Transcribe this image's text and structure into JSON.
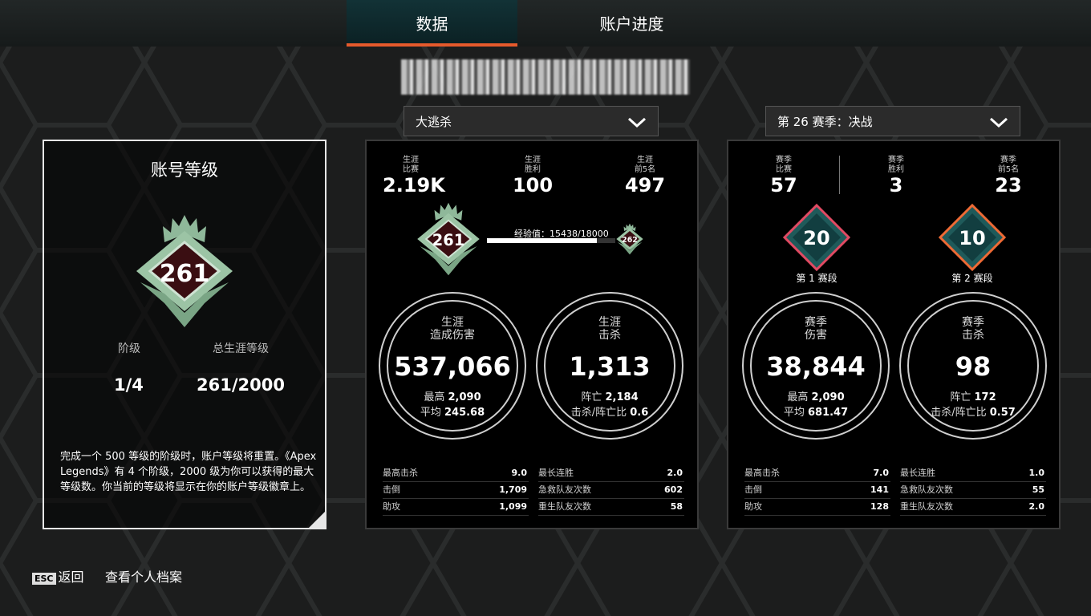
{
  "tabs": [
    {
      "label": "数据",
      "active": true
    },
    {
      "label": "账户进度",
      "active": false
    }
  ],
  "accent_color": "#e65a2c",
  "dropdowns": {
    "mode": "大逃杀",
    "season": "第 26 赛季：决战"
  },
  "account_level": {
    "title": "账号等级",
    "badge_level": "261",
    "tier_label": "阶级",
    "tier_value": "1/4",
    "total_label": "总生涯等级",
    "total_value": "261/2000",
    "description": "完成一个 500 等级的阶级时，账户等级将重置。《Apex Legends》有 4 个阶级，2000 级为你可以获得的最大等级数。你当前的等级将显示在你的账户等级徽章上。"
  },
  "career": {
    "top_stats": [
      {
        "label1": "生涯",
        "label2": "比赛",
        "value": "2.19K"
      },
      {
        "label1": "生涯",
        "label2": "胜利",
        "value": "100"
      },
      {
        "label1": "生涯",
        "label2": "前5名",
        "value": "497"
      }
    ],
    "badge_level": "261",
    "next_level": "262",
    "xp_label": "经验值：15438/18000",
    "xp_progress": 0.8577,
    "damage": {
      "label1": "生涯",
      "label2": "造成伤害",
      "value": "537,066",
      "sub1_label": "最高",
      "sub1_value": "2,090",
      "sub2_label": "平均",
      "sub2_value": "245.68"
    },
    "kills": {
      "label1": "生涯",
      "label2": "击杀",
      "value": "1,313",
      "sub1_label": "阵亡",
      "sub1_value": "2,184",
      "sub2_label": "击杀/阵亡比",
      "sub2_value": "0.6"
    },
    "left_rows": [
      {
        "label": "最高击杀",
        "value": "9.0"
      },
      {
        "label": "击倒",
        "value": "1,709"
      },
      {
        "label": "助攻",
        "value": "1,099"
      }
    ],
    "right_rows": [
      {
        "label": "最长连胜",
        "value": "2.0"
      },
      {
        "label": "急救队友次数",
        "value": "602"
      },
      {
        "label": "重生队友次数",
        "value": "58"
      }
    ]
  },
  "season": {
    "top_stats": [
      {
        "label1": "赛季",
        "label2": "比赛",
        "value": "57"
      },
      {
        "label1": "赛季",
        "label2": "胜利",
        "value": "3"
      },
      {
        "label1": "赛季",
        "label2": "前5名",
        "value": "23"
      }
    ],
    "split1": {
      "value": "20",
      "label": "第 1 赛段",
      "color": "#e24a63"
    },
    "split2": {
      "value": "10",
      "label": "第 2 赛段",
      "color": "#ef6a35"
    },
    "damage": {
      "label1": "赛季",
      "label2": "伤害",
      "value": "38,844",
      "sub1_label": "最高",
      "sub1_value": "2,090",
      "sub2_label": "平均",
      "sub2_value": "681.47"
    },
    "kills": {
      "label1": "赛季",
      "label2": "击杀",
      "value": "98",
      "sub1_label": "阵亡",
      "sub1_value": "172",
      "sub2_label": "击杀/阵亡比",
      "sub2_value": "0.57"
    },
    "left_rows": [
      {
        "label": "最高击杀",
        "value": "7.0"
      },
      {
        "label": "击倒",
        "value": "141"
      },
      {
        "label": "助攻",
        "value": "128"
      }
    ],
    "right_rows": [
      {
        "label": "最长连胜",
        "value": "1.0"
      },
      {
        "label": "急救队友次数",
        "value": "55"
      },
      {
        "label": "重生队友次数",
        "value": "2.0"
      }
    ]
  },
  "footer": {
    "esc_key": "ESC",
    "back_label": "返回",
    "profile_label": "查看个人档案"
  }
}
